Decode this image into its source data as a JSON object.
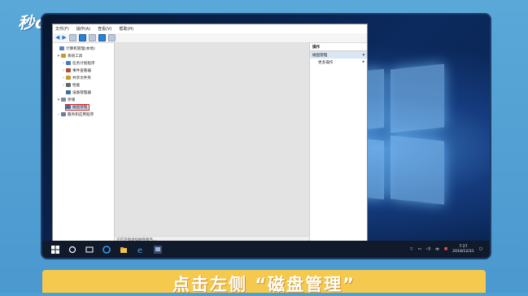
{
  "logo": {
    "text": "秒dong视频"
  },
  "app": {
    "menu": [
      "文件(F)",
      "操作(A)",
      "查看(V)",
      "帮助(H)"
    ],
    "tree": [
      {
        "label": "计算机管理(本地)",
        "caret": "",
        "level": 0,
        "color": "#5a7fbf"
      },
      {
        "label": "系统工具",
        "caret": "▾",
        "level": 1,
        "color": "#c49b2f"
      },
      {
        "label": "任务计划程序",
        "caret": "›",
        "level": 2,
        "color": "#4a7bc2"
      },
      {
        "label": "事件查看器",
        "caret": "›",
        "level": 2,
        "color": "#b44a3a"
      },
      {
        "label": "共享文件夹",
        "caret": "›",
        "level": 2,
        "color": "#c49b2f"
      },
      {
        "label": "性能",
        "caret": "›",
        "level": 2,
        "color": "#666666"
      },
      {
        "label": "设备管理器",
        "caret": "",
        "level": 2,
        "color": "#3b6fb0"
      },
      {
        "label": "存储",
        "caret": "▾",
        "level": 1,
        "color": "#7a8da3"
      },
      {
        "label": "磁盘管理",
        "caret": "",
        "level": 2,
        "color": "#4b6aa5",
        "selected": true
      },
      {
        "label": "服务和应用程序",
        "caret": "›",
        "level": 1,
        "color": "#6a7f95"
      }
    ],
    "status": "正在连接虚拟磁盘服务...",
    "actions": {
      "header": "操作",
      "section": "磁盘管理",
      "section_arrow": "▴",
      "more": "更多操作",
      "more_arrow": "▸"
    }
  },
  "taskbar": {
    "time": "7:27",
    "date": "2018/12/31",
    "ime": "中"
  },
  "caption": "点击左侧 “磁盘管理”"
}
